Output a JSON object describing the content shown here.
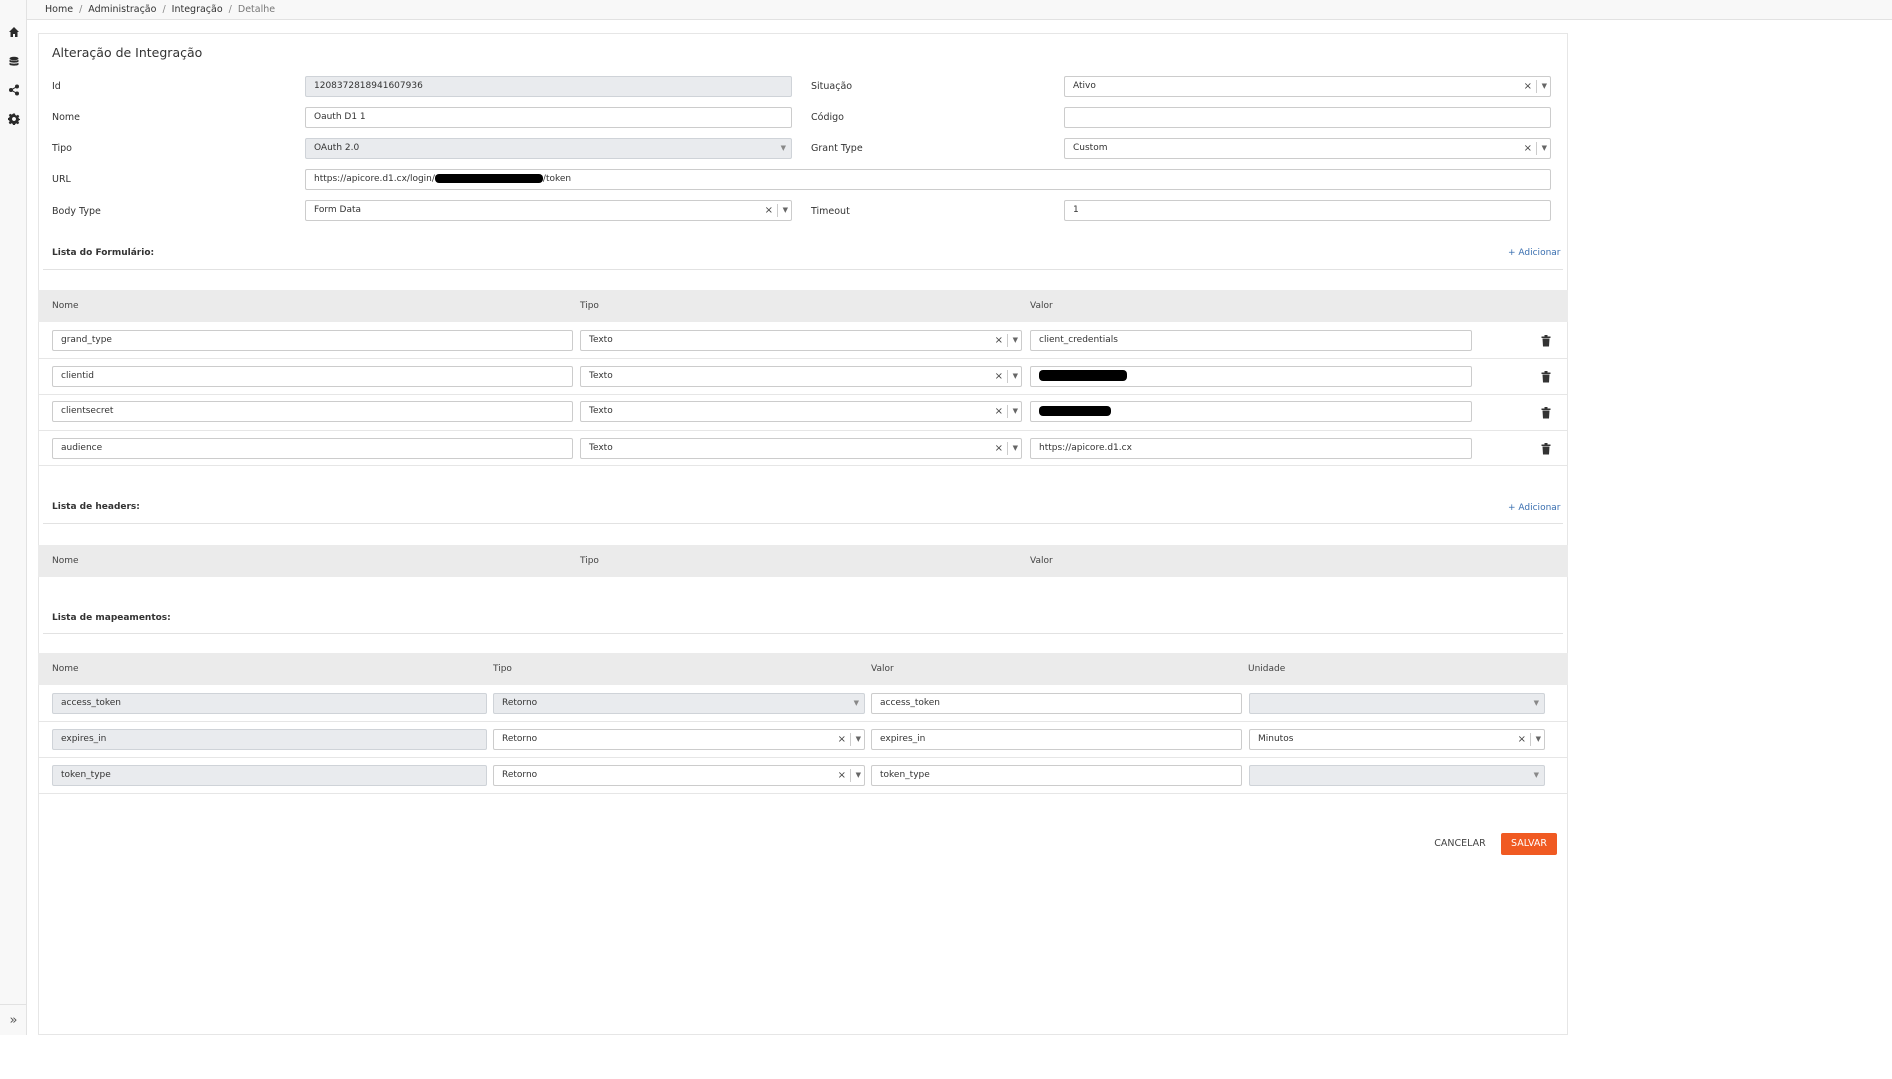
{
  "breadcrumb": [
    "Home",
    "Administração",
    "Integração",
    "Detalhe"
  ],
  "page_title": "Alteração de Integração",
  "form": {
    "id_label": "Id",
    "id_value": "1208372818941607936",
    "situacao_label": "Situação",
    "situacao_value": "Ativo",
    "nome_label": "Nome",
    "nome_value": "Oauth D1 1",
    "codigo_label": "Código",
    "codigo_value": "",
    "tipo_label": "Tipo",
    "tipo_value": "OAuth 2.0",
    "grant_label": "Grant Type",
    "grant_value": "Custom",
    "url_label": "URL",
    "url_prefix": "https://apicore.d1.cx/login/",
    "url_suffix": "/token",
    "body_label": "Body Type",
    "body_value": "Form Data",
    "timeout_label": "Timeout",
    "timeout_value": "1"
  },
  "form_list": {
    "title": "Lista do Formulário:",
    "add": "+ Adicionar",
    "columns": [
      "Nome",
      "Tipo",
      "Valor"
    ],
    "rows": [
      {
        "nome": "grand_type",
        "tipo": "Texto",
        "valor": "client_credentials"
      },
      {
        "nome": "clientid",
        "tipo": "Texto",
        "valor": ""
      },
      {
        "nome": "clientsecret",
        "tipo": "Texto",
        "valor": ""
      },
      {
        "nome": "audience",
        "tipo": "Texto",
        "valor": "https://apicore.d1.cx"
      }
    ]
  },
  "headers_list": {
    "title": "Lista de headers:",
    "add": "+ Adicionar",
    "columns": [
      "Nome",
      "Tipo",
      "Valor"
    ]
  },
  "mappings_list": {
    "title": "Lista de mapeamentos:",
    "columns": [
      "Nome",
      "Tipo",
      "Valor",
      "Unidade"
    ],
    "rows": [
      {
        "nome": "access_token",
        "tipo": "Retorno",
        "valor": "access_token",
        "unidade": ""
      },
      {
        "nome": "expires_in",
        "tipo": "Retorno",
        "valor": "expires_in",
        "unidade": "Minutos"
      },
      {
        "nome": "token_type",
        "tipo": "Retorno",
        "valor": "token_type",
        "unidade": ""
      }
    ]
  },
  "actions": {
    "cancel": "CANCELAR",
    "save": "SALVAR"
  },
  "colors": {
    "accent": "#f05a22",
    "link": "#3a6fb0"
  }
}
